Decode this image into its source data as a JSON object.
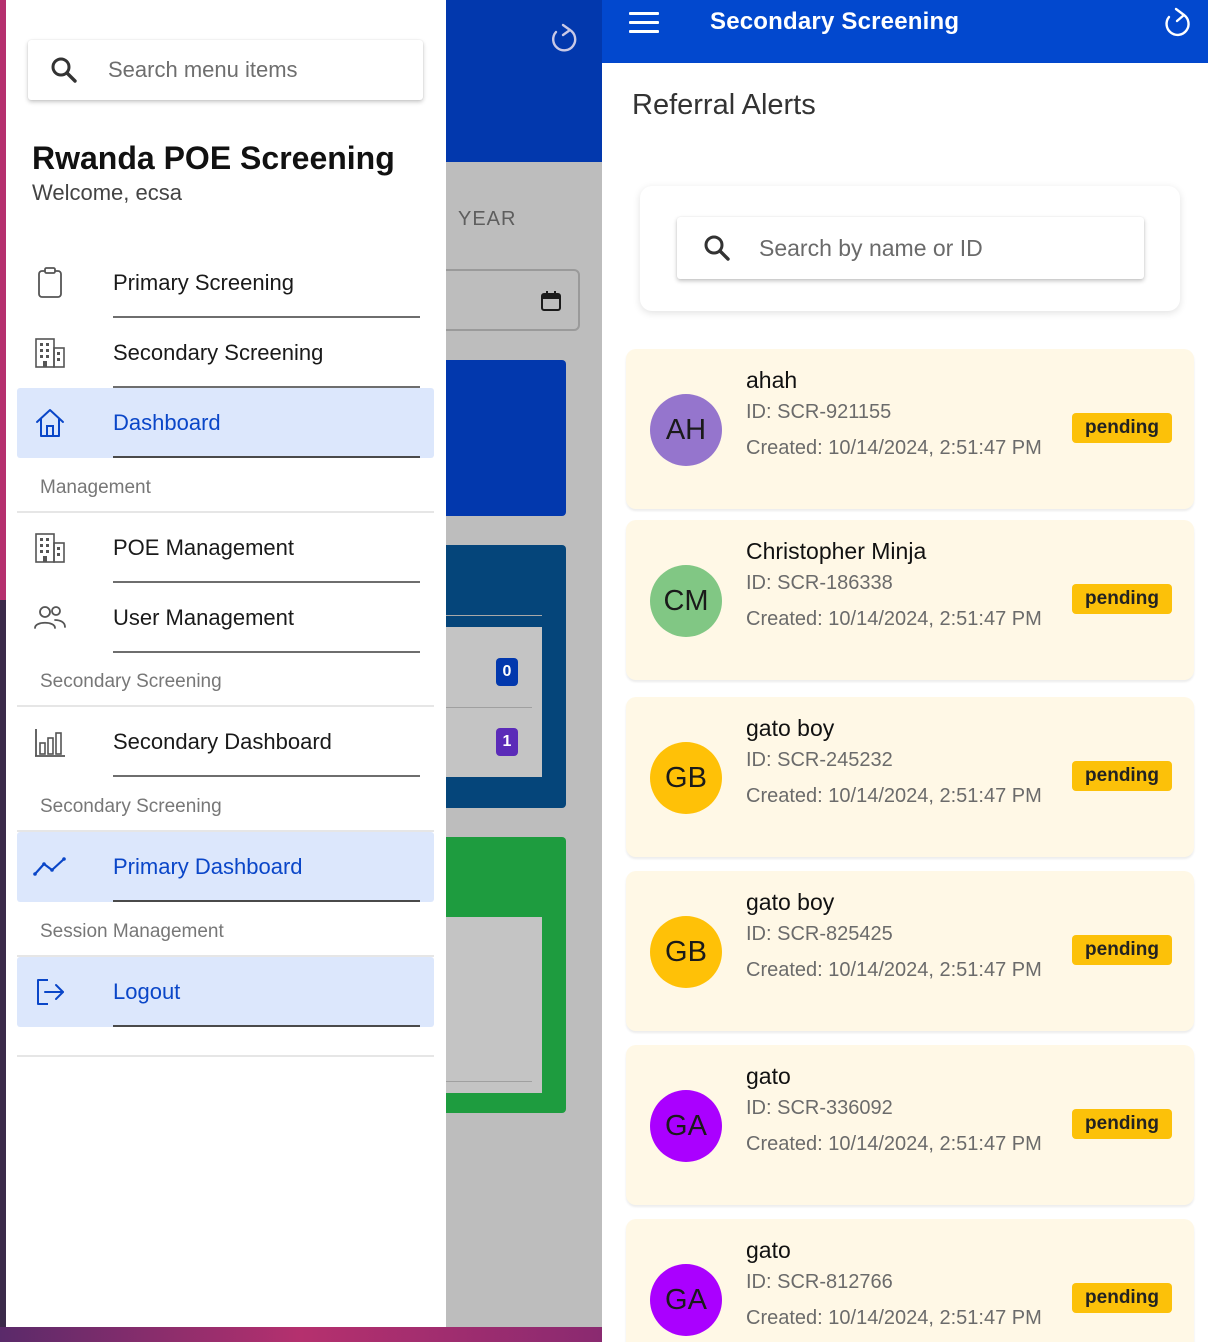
{
  "drawer": {
    "search_placeholder": "Search menu items",
    "app_title": "Rwanda POE Screening",
    "welcome": "Welcome, ecsa",
    "items": [
      {
        "label": "Primary Screening",
        "icon": "clipboard-icon"
      },
      {
        "label": "Secondary Screening",
        "icon": "building-icon"
      },
      {
        "label": "Dashboard",
        "icon": "home-icon"
      },
      {
        "label": "POE Management",
        "icon": "building-icon"
      },
      {
        "label": "User Management",
        "icon": "users-icon"
      },
      {
        "label": "Secondary Dashboard",
        "icon": "bar-chart-icon"
      },
      {
        "label": "Primary Dashboard",
        "icon": "trending-icon"
      },
      {
        "label": "Logout",
        "icon": "logout-icon"
      }
    ],
    "sections": [
      "Management",
      "Secondary Screening",
      "Secondary Screening",
      "Session Management"
    ]
  },
  "background_app": {
    "year_label": "YEAR",
    "badge_counts": [
      "0",
      "1"
    ]
  },
  "topbar": {
    "title": "Secondary Screening"
  },
  "page": {
    "title": "Referral Alerts",
    "search_placeholder": "Search by name or ID"
  },
  "alerts": [
    {
      "initials": "AH",
      "name": "ahah",
      "id": "ID: SCR-921155",
      "created": "Created: 10/14/2024, 2:51:47 PM",
      "status": "pending",
      "avatar_color": "#9575cd"
    },
    {
      "initials": "CM",
      "name": "Christopher Minja",
      "id": "ID: SCR-186338",
      "created": "Created: 10/14/2024, 2:51:47 PM",
      "status": "pending",
      "avatar_color": "#81c784"
    },
    {
      "initials": "GB",
      "name": "gato boy",
      "id": "ID: SCR-245232",
      "created": "Created: 10/14/2024, 2:51:47 PM",
      "status": "pending",
      "avatar_color": "#ffc107"
    },
    {
      "initials": "GB",
      "name": "gato boy",
      "id": "ID: SCR-825425",
      "created": "Created: 10/14/2024, 2:51:47 PM",
      "status": "pending",
      "avatar_color": "#ffc107"
    },
    {
      "initials": "GA",
      "name": "gato",
      "id": "ID: SCR-336092",
      "created": "Created: 10/14/2024, 2:51:47 PM",
      "status": "pending",
      "avatar_color": "#aa00ff"
    },
    {
      "initials": "GA",
      "name": "gato",
      "id": "ID: SCR-812766",
      "created": "Created: 10/14/2024, 2:51:47 PM",
      "status": "pending",
      "avatar_color": "#aa00ff"
    }
  ],
  "colors": {
    "primary": "#0248ce",
    "active_item_bg": "#dce7fc",
    "status_pending": "#fcc109",
    "card_bg": "#fff8e6"
  }
}
